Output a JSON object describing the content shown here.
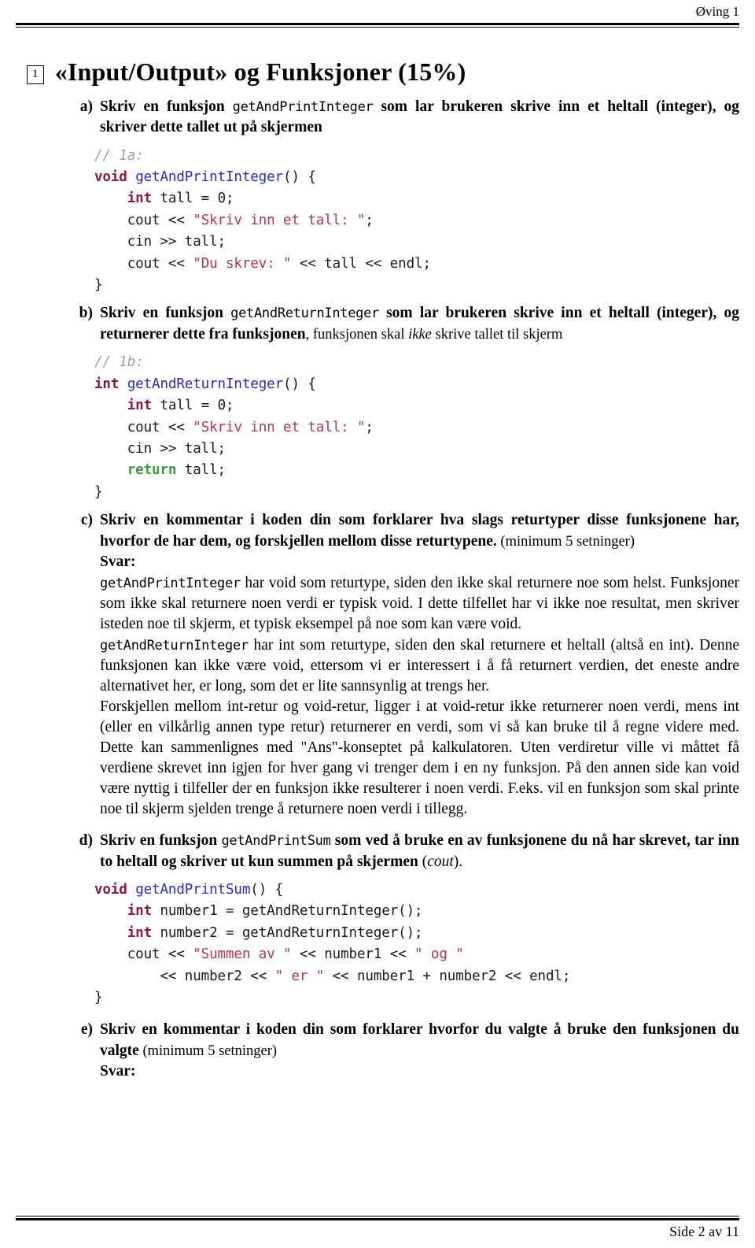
{
  "header": {
    "right_text": "Øving 1"
  },
  "section": {
    "number": "1",
    "title": "«Input/Output» og Funksjoner (15%)"
  },
  "items": {
    "a": {
      "label": "a)",
      "text_bold_1": "Skriv en funksjon ",
      "mono_1": "getAndPrintInteger",
      "text_bold_2": " som lar brukeren skrive inn et heltall (integer), og skriver dette tallet ut på skjermen"
    },
    "b": {
      "label": "b)",
      "text_bold_1": "Skriv en funksjon ",
      "mono_1": "getAndReturnInteger",
      "text_bold_2": " som lar brukeren skrive inn et heltall (integer), og returnerer dette fra funksjonen",
      "text_normal_1": ", funksjonen skal ",
      "text_italic_1": "ikke",
      "text_normal_2": " skrive tallet til skjerm"
    },
    "c": {
      "label": "c)",
      "text_bold_1": "Skriv en kommentar i koden din som forklarer hva slags returtyper disse funksjonene har, hvorfor de har dem, og forskjellen mellom disse returtypene.",
      "text_normal_1": " (minimum 5 setninger)",
      "svar_label": "Svar:",
      "answers": [
        {
          "mono_lead": "getAndPrintInteger",
          "text": " har void som returtype, siden den ikke skal returnere noe som helst. Funksjoner som ikke skal returnere noen verdi er typisk void. I dette tilfellet har vi ikke noe resultat, men skriver isteden noe til skjerm, et typisk eksempel på noe som kan være void."
        },
        {
          "mono_lead": "getAndReturnInteger",
          "text": " har int som returtype, siden den skal returnere et heltall (altså en int). Denne funksjonen kan ikke være void, ettersom vi er interessert i å få returnert verdien, det eneste andre alternativet her, er long, som det er lite sannsynlig at trengs her."
        },
        {
          "mono_lead": "",
          "text": "Forskjellen mellom int-retur og void-retur, ligger i at void-retur ikke returnerer noen verdi, mens int (eller en vilkårlig annen type retur) returnerer en verdi, som vi så kan bruke til å regne videre med. Dette kan sammenlignes med \"Ans\"-konseptet på kalkulatoren. Uten verdiretur ville vi måttet få verdiene skrevet inn igjen for hver gang vi trenger dem i en ny funksjon. På den annen side kan void være nyttig i tilfeller der en funksjon ikke resulterer i noen verdi. F.eks. vil en funksjon som skal printe noe til skjerm sjelden trenge å returnere noen verdi i tillegg."
        }
      ]
    },
    "d": {
      "label": "d)",
      "text_bold_1": "Skriv en funksjon ",
      "mono_1": "getAndPrintSum",
      "text_bold_2": " som ved å bruke en av funksjonene du nå har skrevet, tar inn to heltall og skriver ut kun summen på skjermen ",
      "text_normal_1": "(",
      "text_italic_1": "cout",
      "text_normal_2": ")."
    },
    "e": {
      "label": "e)",
      "text_bold_1": "Skriv en kommentar i koden din som forklarer hvorfor du valgte å bruke den funksjonen du valgte",
      "text_normal_1": " (minimum 5 setninger)",
      "svar_label": "Svar:"
    }
  },
  "code": {
    "block_1a": {
      "caption": "// 1a:",
      "lines": [
        "void getAndPrintInteger() {",
        "    int tall = 0;",
        "    cout << \"Skriv inn et tall: \";",
        "    cin >> tall;",
        "    cout << \"Du skrev: \" << tall << endl;",
        "}"
      ]
    },
    "block_1b": {
      "caption": "// 1b:",
      "lines": [
        "int getAndReturnInteger() {",
        "    int tall = 0;",
        "    cout << \"Skriv inn et tall: \";",
        "    cin >> tall;",
        "    return tall;",
        "}"
      ]
    },
    "block_1d": {
      "caption": "",
      "lines": [
        "void getAndPrintSum() {",
        "    int number1 = getAndReturnInteger();",
        "    int number2 = getAndReturnInteger();",
        "    cout << \"Summen av \" << number1 << \" og \"",
        "        << number2 << \" er \" << number1 + number2 << endl;",
        "}"
      ]
    }
  },
  "footer": {
    "text": "Side 2 av 11"
  },
  "colors": {
    "comment": "#9ba2b2",
    "keyword": "#8a1a48",
    "return_keyword": "#3d9b3d",
    "function": "#2b2bbf",
    "string": "#b0394c",
    "plain": "#1a1a1a"
  }
}
